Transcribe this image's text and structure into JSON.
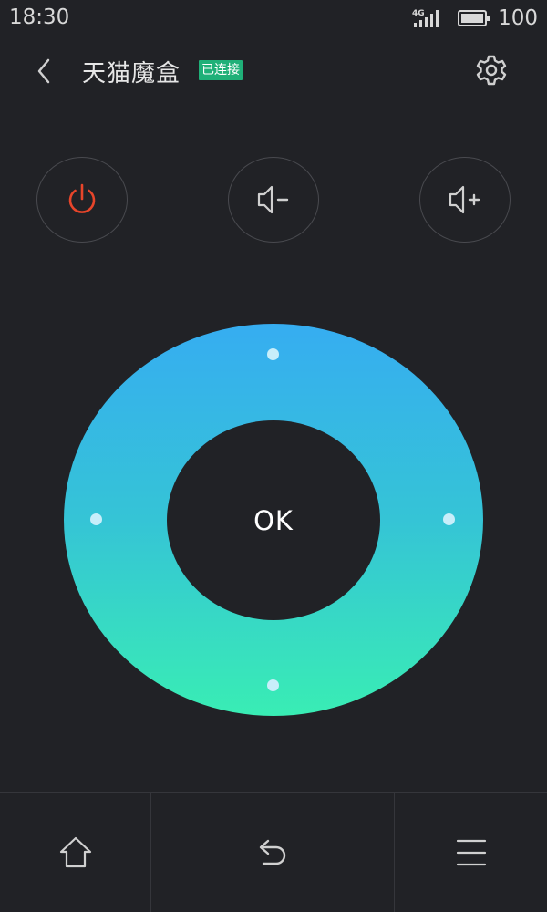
{
  "status_bar": {
    "time": "18:30",
    "network": "4G",
    "battery": "100",
    "icons": [
      "signal-icon",
      "battery-icon"
    ]
  },
  "header": {
    "device_name": "天猫魔盒",
    "connection_status": "已连接",
    "icons": [
      "back-arrow-icon",
      "gear-icon"
    ]
  },
  "controls": {
    "icons": [
      "power-icon",
      "volume-down-icon",
      "volume-up-icon"
    ]
  },
  "dpad": {
    "ok_label": "OK"
  },
  "bottom_nav": {
    "icons": [
      "home-icon",
      "return-icon",
      "menu-icon"
    ]
  },
  "colors": {
    "background": "#212226",
    "power_accent": "#e8452a",
    "connected_badge": "#1fb078",
    "dpad_gradient_top": "#36adf1",
    "dpad_gradient_bottom": "#39edb4"
  }
}
